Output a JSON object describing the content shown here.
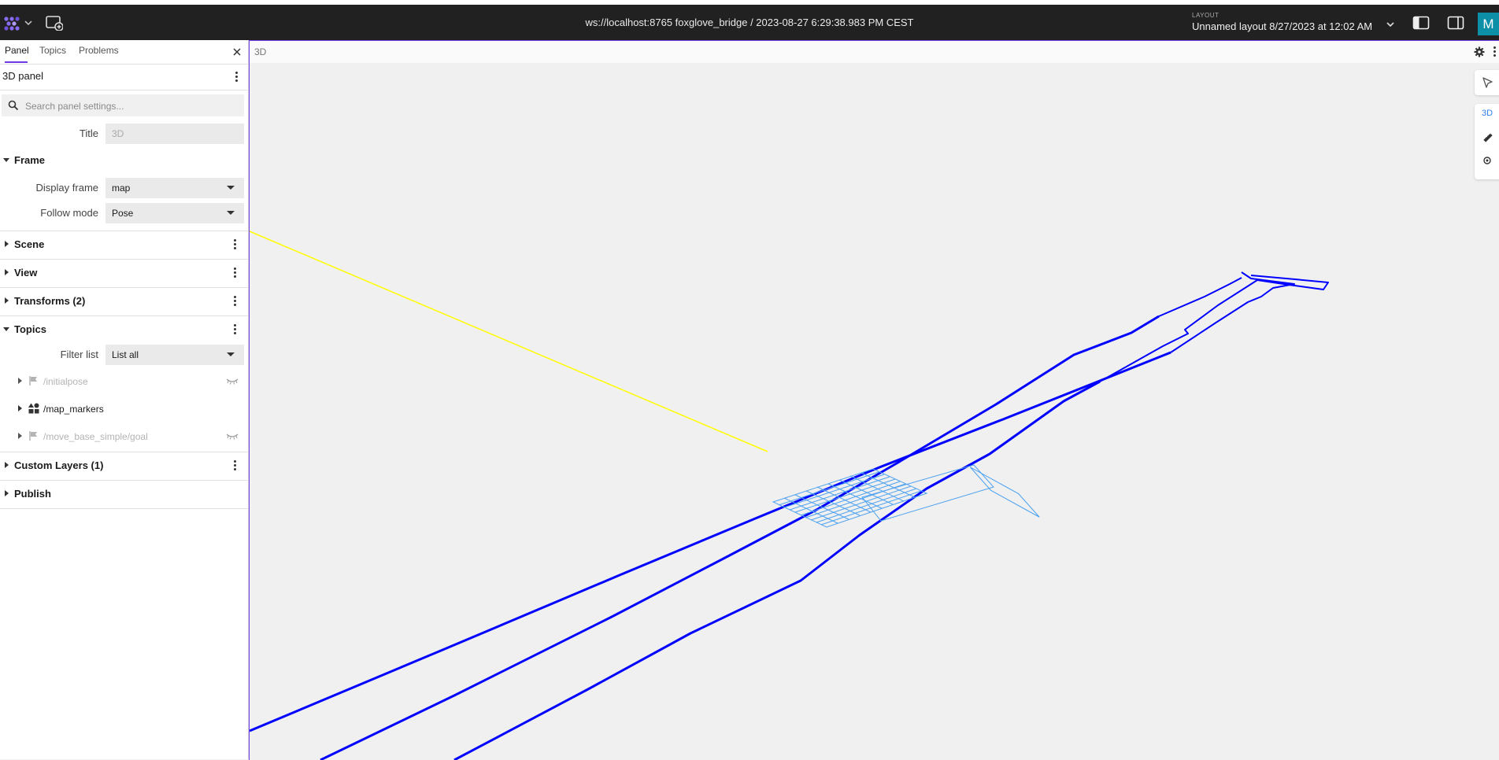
{
  "topbar": {
    "connection_title": "ws://localhost:8765 foxglove_bridge / 2023-08-27 6:29:38.983 PM CEST",
    "layout_label": "LAYOUT",
    "layout_name": "Unnamed layout 8/27/2023 at 12:02 AM",
    "avatar_initial": "M"
  },
  "sidebar": {
    "tabs": [
      "Panel",
      "Topics",
      "Problems"
    ],
    "panel_title": "3D panel",
    "search_placeholder": "Search panel settings...",
    "title_label": "Title",
    "title_value": "3D",
    "frame": {
      "section": "Frame",
      "display_frame_label": "Display frame",
      "display_frame_value": "map",
      "follow_mode_label": "Follow mode",
      "follow_mode_value": "Pose"
    },
    "sections": {
      "scene": "Scene",
      "view": "View",
      "transforms": "Transforms (2)",
      "topics": "Topics",
      "custom_layers": "Custom Layers (1)",
      "publish": "Publish"
    },
    "topics": {
      "filter_label": "Filter list",
      "filter_value": "List all",
      "items": [
        {
          "name": "/initialpose",
          "icon": "flag-icon",
          "visible": false
        },
        {
          "name": "/map_markers",
          "icon": "shapes-icon",
          "visible": true
        },
        {
          "name": "/move_base_simple/goal",
          "icon": "flag-icon",
          "visible": false
        }
      ]
    }
  },
  "viewport": {
    "panel_title": "3D",
    "tools": {
      "view_mode": "3D"
    }
  },
  "colors": {
    "accent": "#6f3be8",
    "topbar_bg": "#212121",
    "avatar_bg": "#0d8fa8",
    "path_line": "#0000ff",
    "pose_line": "#ffff00",
    "grid": "#4ea2f0",
    "view_mode_active": "#2d7ff0"
  }
}
